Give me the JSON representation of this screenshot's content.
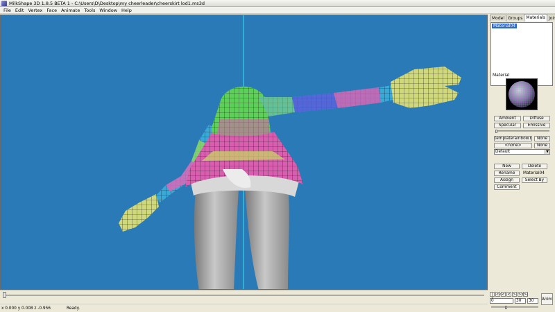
{
  "window": {
    "title": "MilkShape 3D 1.8.5 BETA 1 - C:\\Users\\D\\Desktop\\my cheerleader\\cheerskirt lod1.ms3d"
  },
  "menu": [
    "File",
    "Edit",
    "Vertex",
    "Face",
    "Animate",
    "Tools",
    "Window",
    "Help"
  ],
  "tabs": [
    {
      "label": "Model",
      "active": false
    },
    {
      "label": "Groups",
      "active": false
    },
    {
      "label": "Materials",
      "active": true
    },
    {
      "label": "Joints",
      "active": false
    }
  ],
  "materials": {
    "list": [
      "Material04"
    ],
    "section_label": "Material",
    "ambient": "Ambient",
    "diffuse": "Diffuse",
    "specular": "Specular",
    "emissive": "Emissive",
    "texture1": "templaterainbow.bmp",
    "texture1_none": "None",
    "texture2": "<none>",
    "texture2_none": "None",
    "mode": "Default",
    "new": "New",
    "delete": "Delete",
    "rename": "Rename",
    "name_value": "Material04",
    "assign": "Assign",
    "select_by": "Select By",
    "comment": "Comment"
  },
  "status": {
    "coords": "x 0.000 y 0.008 z -0.956",
    "message": "Ready."
  },
  "animation": {
    "frame": "0",
    "start": "30",
    "end": "30",
    "anim_label": "Anim",
    "controls": [
      "|<",
      "<<",
      "<",
      "<",
      ">",
      ">>",
      ">|"
    ]
  },
  "colors": {
    "viewport_bg": "#2a7ab8",
    "selection": "#316ac5"
  }
}
